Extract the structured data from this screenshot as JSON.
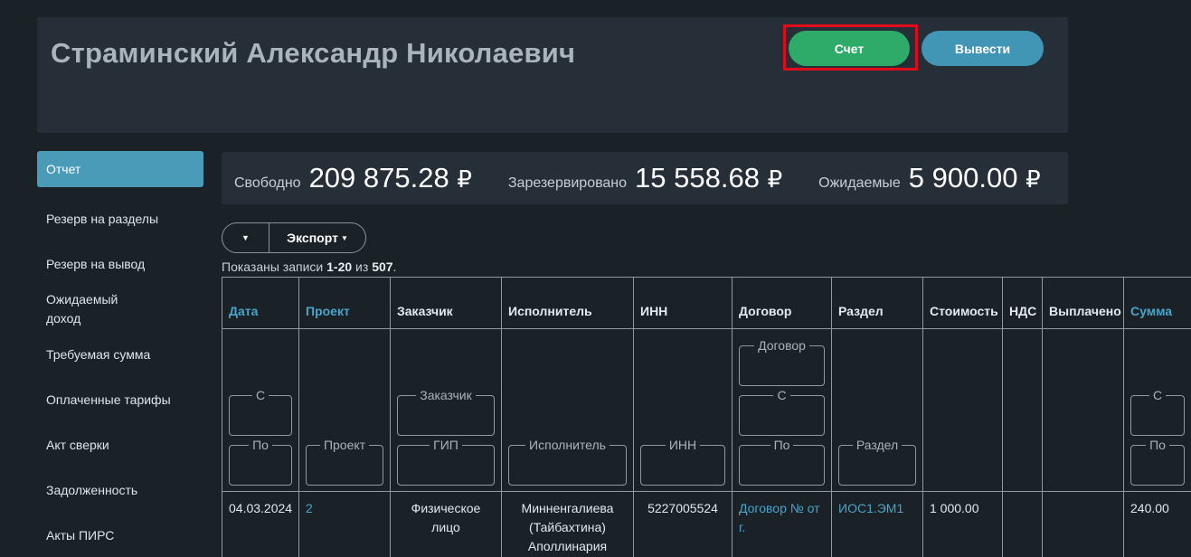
{
  "header": {
    "title": "Страминский Александр Николаевич",
    "invoice_label": "Счет",
    "withdraw_label": "Вывести"
  },
  "sidebar": {
    "items": [
      {
        "label": "Отчет",
        "active": true
      },
      {
        "label": "Резерв на разделы"
      },
      {
        "label": "Резерв на вывод"
      },
      {
        "label": "Ожидаемый доход"
      },
      {
        "label": "Требуемая сумма"
      },
      {
        "label": "Оплаченные тарифы"
      },
      {
        "label": "Акт сверки"
      },
      {
        "label": "Задолженность"
      },
      {
        "label": "Акты ПИРС"
      }
    ]
  },
  "balance": {
    "free_label": "Свободно",
    "free_value": "209 875.28",
    "reserved_label": "Зарезервировано",
    "reserved_value": "15 558.68",
    "expected_label": "Ожидаемые",
    "expected_value": "5 900.00",
    "currency": "₽"
  },
  "toolbar": {
    "export_label": "Экспорт"
  },
  "summary": {
    "prefix": "Показаны записи",
    "range": "1-20",
    "of": "из",
    "total": "507"
  },
  "table": {
    "columns": [
      "Дата",
      "Проект",
      "Заказчик",
      "Исполнитель",
      "ИНН",
      "Договор",
      "Раздел",
      "Стоимость",
      "НДС",
      "Выплачено",
      "Сумма"
    ],
    "filters": {
      "date_from": "С",
      "date_to": "По",
      "project": "Проект",
      "customer": "Заказчик",
      "gip": "ГИП",
      "executor": "Исполнитель",
      "inn": "ИНН",
      "contract": "Договор",
      "contract_from": "С",
      "contract_to": "По",
      "section": "Раздел",
      "sum_from": "С",
      "sum_to": "По"
    },
    "rows": [
      {
        "date": "04.03.2024",
        "project": "2",
        "customer": "Физическое лицо",
        "executor": "Минненгалиева (Тайбахтина) Аполлинария",
        "inn": "5227005524",
        "contract": "Договор № от г.",
        "section": "ИОС1.ЭМ1",
        "cost": "1 000.00",
        "vat": "",
        "paid": "",
        "sum": "240.00"
      }
    ]
  },
  "colors": {
    "accent_green": "#2eab69",
    "accent_blue": "#4195b5",
    "link": "#4aa3c8",
    "highlight": "#e10b1c"
  },
  "icons": {
    "caret": "caret-down-icon"
  }
}
